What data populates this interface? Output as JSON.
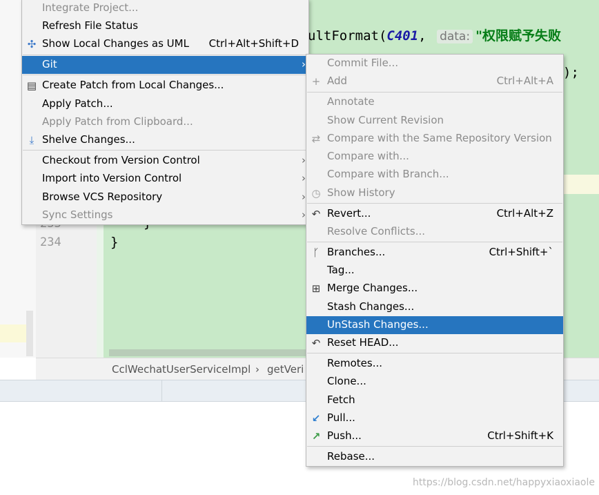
{
  "editor": {
    "line_numbers": [
      "233",
      "234"
    ],
    "code_top": {
      "prefix": "ultFormat(",
      "constant": "C401",
      "comma": ",",
      "hint": "data:",
      "string": "\"权限赋予失败"
    },
    "code_right": ");",
    "brace_inner": "}",
    "brace_outer": "}"
  },
  "breadcrumb": {
    "class_name": "CclWechatUserServiceImpl",
    "separator": "›",
    "method": "getVeri"
  },
  "watermark": "https://blog.csdn.net/happyxiaoxiaole",
  "vcs_menu": {
    "items": [
      {
        "label": "Integrate Project...",
        "disabled": true
      },
      {
        "label": "Refresh File Status",
        "disabled": false
      },
      {
        "label": "Show Local Changes as UML",
        "shortcut": "Ctrl+Alt+Shift+D",
        "icon": "uml-diagram-icon"
      },
      {
        "label": "Git",
        "selected": true,
        "submenu": true
      },
      {
        "label": "Create Patch from Local Changes...",
        "icon": "create-patch-icon"
      },
      {
        "label": "Apply Patch..."
      },
      {
        "label": "Apply Patch from Clipboard...",
        "disabled": true
      },
      {
        "label": "Shelve Changes...",
        "icon": "shelve-icon"
      },
      {
        "label": "Checkout from Version Control",
        "submenu": true
      },
      {
        "label": "Import into Version Control",
        "submenu": true
      },
      {
        "label": "Browse VCS Repository",
        "submenu": true
      },
      {
        "label": "Sync Settings",
        "disabled": true,
        "submenu": true
      }
    ]
  },
  "git_menu": {
    "items": [
      {
        "label": "Commit File...",
        "disabled": true
      },
      {
        "label": "Add",
        "shortcut": "Ctrl+Alt+A",
        "disabled": true,
        "icon": "add-icon"
      },
      {
        "label": "Annotate",
        "disabled": true
      },
      {
        "label": "Show Current Revision",
        "disabled": true
      },
      {
        "label": "Compare with the Same Repository Version",
        "disabled": true,
        "icon": "compare-icon"
      },
      {
        "label": "Compare with...",
        "disabled": true
      },
      {
        "label": "Compare with Branch...",
        "disabled": true
      },
      {
        "label": "Show History",
        "disabled": true,
        "icon": "history-icon"
      },
      {
        "label": "Revert...",
        "shortcut": "Ctrl+Alt+Z",
        "icon": "revert-icon"
      },
      {
        "label": "Resolve Conflicts...",
        "disabled": true
      },
      {
        "label": "Branches...",
        "shortcut": "Ctrl+Shift+`",
        "icon": "branch-icon"
      },
      {
        "label": "Tag..."
      },
      {
        "label": "Merge Changes...",
        "icon": "merge-icon"
      },
      {
        "label": "Stash Changes..."
      },
      {
        "label": "UnStash Changes...",
        "selected": true
      },
      {
        "label": "Reset HEAD...",
        "icon": "reset-icon"
      },
      {
        "label": "Remotes..."
      },
      {
        "label": "Clone..."
      },
      {
        "label": "Fetch"
      },
      {
        "label": "Pull...",
        "icon": "pull-icon"
      },
      {
        "label": "Push...",
        "shortcut": "Ctrl+Shift+K",
        "icon": "push-icon"
      },
      {
        "label": "Rebase..."
      }
    ]
  },
  "colors": {
    "selection": "#2675bf",
    "editor_bg": "#c8e9c8",
    "menu_bg": "#f2f2f2"
  }
}
